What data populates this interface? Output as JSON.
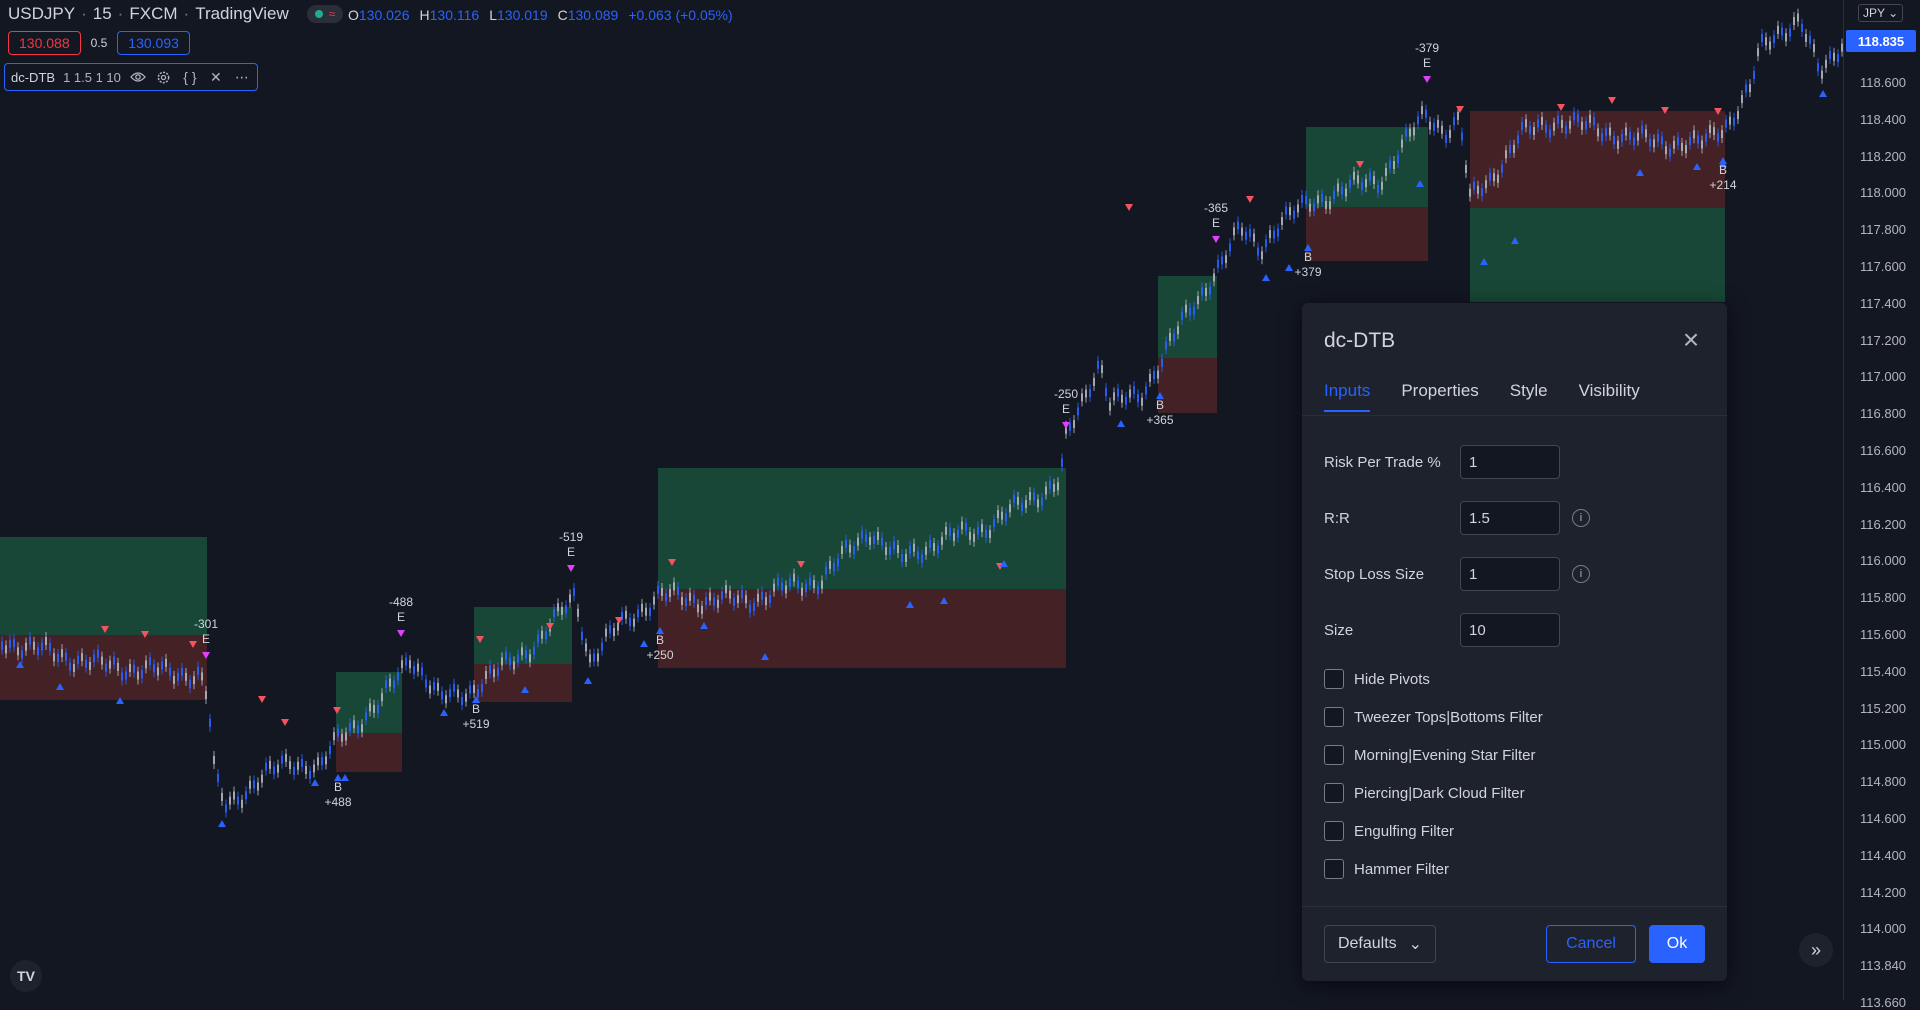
{
  "header": {
    "symbol": "USDJPY",
    "interval": "15",
    "exchange": "FXCM",
    "brand": "TradingView",
    "ohlc": {
      "open_label": "O",
      "open": "130.026",
      "high_label": "H",
      "high": "130.116",
      "low_label": "L",
      "low": "130.019",
      "close_label": "C",
      "close": "130.089",
      "change": "+0.063 (+0.05%)"
    },
    "bid": "130.088",
    "spread": "0.5",
    "ask": "130.093"
  },
  "indicator_legend": {
    "name": "dc-DTB",
    "args": "1 1.5 1 10",
    "icons": [
      "eye-icon",
      "gear-icon",
      "source-code-icon",
      "close-icon",
      "more-icon"
    ]
  },
  "price_scale": {
    "currency": "JPY",
    "current_price": "118.835",
    "ticks": [
      "118.600",
      "118.400",
      "118.200",
      "118.000",
      "117.800",
      "117.600",
      "117.400",
      "117.200",
      "117.000",
      "116.800",
      "116.600",
      "116.400",
      "116.200",
      "116.000",
      "115.800",
      "115.600",
      "115.400",
      "115.200",
      "115.000",
      "114.800",
      "114.600",
      "114.400",
      "114.200",
      "114.000",
      "113.840",
      "113.660"
    ]
  },
  "trade_labels": {
    "entries": [
      "-301",
      "-488",
      "-519",
      "-250",
      "-365",
      "-379"
    ],
    "entry_tag": "E",
    "exits": [
      "+488",
      "+519",
      "+250",
      "+365",
      "+379",
      "+214"
    ],
    "exit_tag": "B"
  },
  "dialog": {
    "title": "dc-DTB",
    "tabs": [
      "Inputs",
      "Properties",
      "Style",
      "Visibility"
    ],
    "active_tab": "Inputs",
    "fields": [
      {
        "label": "Risk Per Trade %",
        "value": "1",
        "info": false
      },
      {
        "label": "R:R",
        "value": "1.5",
        "info": true
      },
      {
        "label": "Stop Loss Size",
        "value": "1",
        "info": true
      },
      {
        "label": "Size",
        "value": "10",
        "info": false
      }
    ],
    "checkboxes": [
      {
        "label": "Hide Pivots",
        "checked": false
      },
      {
        "label": "Tweezer Tops|Bottoms Filter",
        "checked": false
      },
      {
        "label": "Morning|Evening Star Filter",
        "checked": false
      },
      {
        "label": "Piercing|Dark Cloud Filter",
        "checked": false
      },
      {
        "label": "Engulfing Filter",
        "checked": false
      },
      {
        "label": "Hammer Filter",
        "checked": false
      }
    ],
    "defaults_label": "Defaults",
    "cancel_label": "Cancel",
    "ok_label": "Ok"
  },
  "colors": {
    "background": "#131722",
    "accent": "#2962ff",
    "profit_zone": "#1b4d3a",
    "loss_zone": "#4a2226",
    "bull_candle": "#2962ff",
    "bear_candle": "#b2b5be",
    "pivot_high": "#f7525f",
    "pivot_low": "#2962ff",
    "trade_marker": "#e040fb"
  }
}
